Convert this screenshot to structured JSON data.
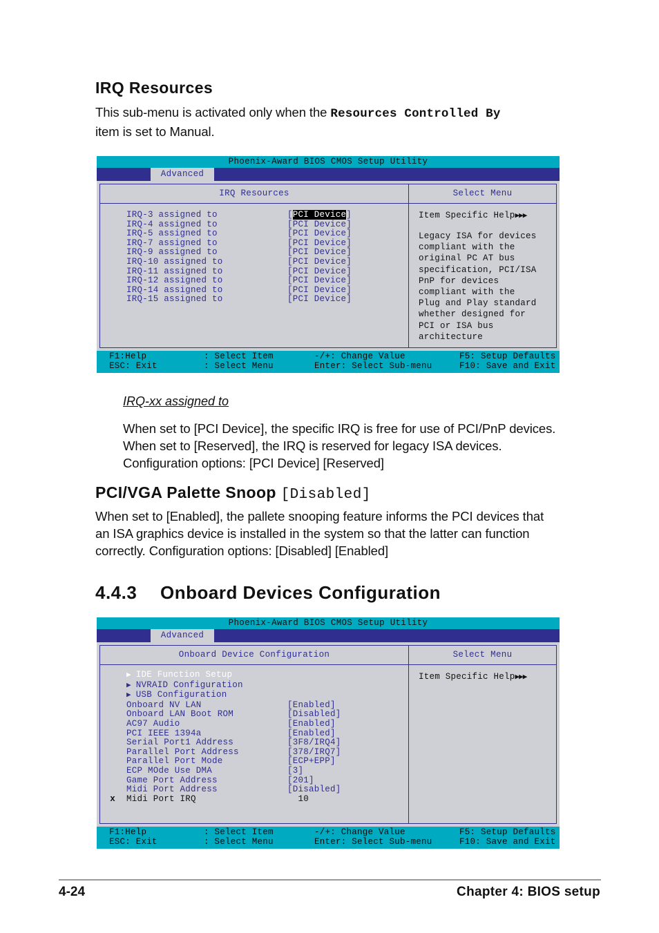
{
  "section_irq": {
    "heading": "IRQ Resources",
    "intro_before": "This sub-menu is activated only when the ",
    "intro_bold": "Resources Controlled By",
    "intro_after_line": "item is set to Manual."
  },
  "bios_screen_1": {
    "title": "Phoenix-Award BIOS CMOS Setup Utility",
    "tab": "Advanced",
    "left_header": "IRQ Resources",
    "right_header": "Select Menu",
    "rows": [
      {
        "label": "IRQ-3 assigned to",
        "value": "PCI Device",
        "selected": true
      },
      {
        "label": "IRQ-4 assigned to",
        "value": "PCI Device",
        "selected": false
      },
      {
        "label": "IRQ-5 assigned to",
        "value": "PCI Device",
        "selected": false
      },
      {
        "label": "IRQ-7 assigned to",
        "value": "PCI Device",
        "selected": false
      },
      {
        "label": "IRQ-9 assigned to",
        "value": "PCI Device",
        "selected": false
      },
      {
        "label": "IRQ-10 assigned to",
        "value": "PCI Device",
        "selected": false
      },
      {
        "label": "IRQ-11 assigned to",
        "value": "PCI Device",
        "selected": false
      },
      {
        "label": "IRQ-12 assigned to",
        "value": "PCI Device",
        "selected": false
      },
      {
        "label": "IRQ-14 assigned to",
        "value": "PCI Device",
        "selected": false
      },
      {
        "label": "IRQ-15 assigned to",
        "value": "PCI Device",
        "selected": false
      }
    ],
    "help_title": "Item Specific Help",
    "help_text": "Legacy ISA for devices\ncompliant with the\noriginal PC AT bus\nspecification, PCI/ISA\nPnP for devices\ncompliant with the\nPlug and Play standard\nwhether designed for\nPCI or ISA bus\narchitecture",
    "footer": {
      "f1": "F1:Help",
      "esc": "ESC: Exit",
      "select_item": ": Select Item",
      "select_menu": ": Select Menu",
      "change_value": "-/+: Change Value",
      "select_submenu": "Enter: Select Sub-menu",
      "setup_defaults": "F5: Setup Defaults",
      "save_exit": "F10: Save and Exit"
    }
  },
  "section_irq_xx": {
    "sub_heading": "IRQ-xx assigned to",
    "body": "When set to [PCI Device], the specific IRQ is free for use of PCI/PnP devices. When set to [Reserved], the IRQ is reserved for legacy ISA devices. Configuration options: [PCI Device] [Reserved]"
  },
  "section_palette": {
    "heading_bold": "PCI/VGA Palette Snoop",
    "heading_value": "[Disabled]",
    "body": "When set to [Enabled], the pallete snooping feature informs the PCI devices that an ISA graphics device is installed in the system so that the latter can function correctly. Configuration options: [Disabled] [Enabled]"
  },
  "section_443": {
    "number": "4.4.3",
    "title": "Onboard Devices Configuration"
  },
  "bios_screen_2": {
    "title": "Phoenix-Award BIOS CMOS Setup Utility",
    "tab": "Advanced",
    "left_header": "Onboard Device Configuration",
    "right_header": "Select Menu",
    "rows": [
      {
        "marker": "",
        "submenu": true,
        "label": "IDE Function Setup",
        "value": "",
        "highlighted": true,
        "dim": false
      },
      {
        "marker": "",
        "submenu": true,
        "label": "NVRAID Configuration",
        "value": "",
        "highlighted": false,
        "dim": false
      },
      {
        "marker": "",
        "submenu": true,
        "label": "USB Configuration",
        "value": "",
        "highlighted": false,
        "dim": false
      },
      {
        "marker": "",
        "submenu": false,
        "label": "Onboard NV LAN",
        "value": "[Enabled]",
        "highlighted": false,
        "dim": false
      },
      {
        "marker": "",
        "submenu": false,
        "label": "Onboard LAN Boot ROM",
        "value": "[Disabled]",
        "highlighted": false,
        "dim": false
      },
      {
        "marker": "",
        "submenu": false,
        "label": "AC97 Audio",
        "value": "[Enabled]",
        "highlighted": false,
        "dim": false
      },
      {
        "marker": "",
        "submenu": false,
        "label": "PCI IEEE 1394a",
        "value": "[Enabled]",
        "highlighted": false,
        "dim": false
      },
      {
        "marker": "",
        "submenu": false,
        "label": "Serial Port1 Address",
        "value": "[3F8/IRQ4]",
        "highlighted": false,
        "dim": false
      },
      {
        "marker": "",
        "submenu": false,
        "label": "Parallel Port Address",
        "value": "[378/IRQ7]",
        "highlighted": false,
        "dim": false
      },
      {
        "marker": "",
        "submenu": false,
        "label": "Parallel Port Mode",
        "value": "[ECP+EPP]",
        "highlighted": false,
        "dim": false
      },
      {
        "marker": "",
        "submenu": false,
        "label": "ECP MOde Use DMA",
        "value": "[3]",
        "highlighted": false,
        "dim": false
      },
      {
        "marker": "",
        "submenu": false,
        "label": "Game Port Address",
        "value": "[201]",
        "highlighted": false,
        "dim": false
      },
      {
        "marker": "",
        "submenu": false,
        "label": "Midi Port Address",
        "value": "[Disabled]",
        "highlighted": false,
        "dim": false
      },
      {
        "marker": "x",
        "submenu": false,
        "label": "Midi Port IRQ",
        "value": "  10",
        "highlighted": false,
        "dim": true
      }
    ],
    "help_title": "Item Specific Help",
    "footer": {
      "f1": "F1:Help",
      "esc": "ESC: Exit",
      "select_item": ": Select Item",
      "select_menu": ": Select Menu",
      "change_value": "-/+: Change Value",
      "select_submenu": "Enter: Select Sub-menu",
      "setup_defaults": "F5: Setup Defaults",
      "save_exit": "F10: Save and Exit"
    }
  },
  "page_footer": {
    "page_number": "4-24",
    "chapter": "Chapter 4: BIOS setup"
  },
  "colors": {
    "title_bar": "#00abc2",
    "tab_bar": "#302e8f",
    "panel_bg": "#cfd0d5",
    "text_blue": "#302e8f",
    "selected_bg": "#000000"
  }
}
